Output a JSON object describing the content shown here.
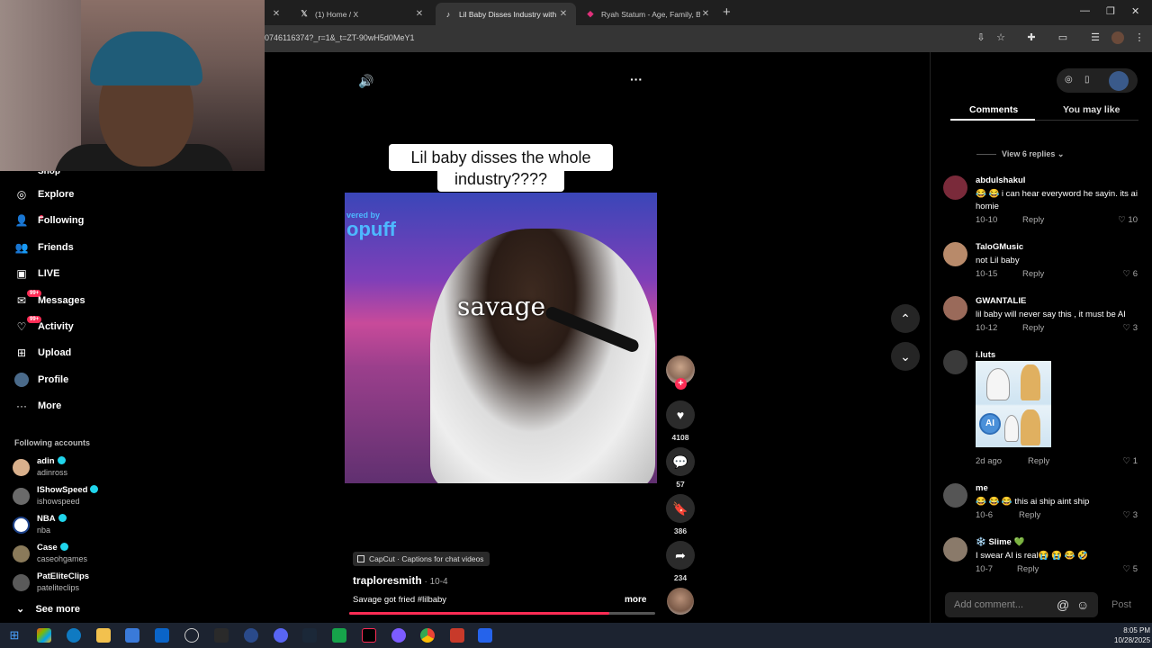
{
  "browser": {
    "tabs": [
      {
        "label": "(1) Home / X",
        "icon": "x-logo-icon"
      },
      {
        "label": "Lil Baby Disses Industry with Sa",
        "icon": "tiktok-logo-icon"
      },
      {
        "label": "Ryah Statum - Age, Family, Bio",
        "icon": "site-icon"
      }
    ],
    "url": "0746116374?_r=1&_t=ZT-90wH5d0MeY1"
  },
  "sidebar": {
    "partial_item": "Shop",
    "items": [
      {
        "label": "Explore",
        "icon": "compass-icon"
      },
      {
        "label": "Following",
        "icon": "following-icon"
      },
      {
        "label": "Friends",
        "icon": "friends-icon"
      },
      {
        "label": "LIVE",
        "icon": "live-icon"
      },
      {
        "label": "Messages",
        "icon": "messages-icon",
        "badge": "99+"
      },
      {
        "label": "Activity",
        "icon": "activity-icon",
        "badge": "99+"
      },
      {
        "label": "Upload",
        "icon": "upload-icon"
      },
      {
        "label": "Profile",
        "icon": "profile-icon"
      },
      {
        "label": "More",
        "icon": "more-dots-icon"
      }
    ],
    "following_title": "Following accounts",
    "following": [
      {
        "name": "adin",
        "user": "adinross",
        "verified": true,
        "color": "#d9b08c"
      },
      {
        "name": "IShowSpeed",
        "user": "ishowspeed",
        "verified": true,
        "color": "#6a6a6a"
      },
      {
        "name": "NBA",
        "user": "nba",
        "verified": true,
        "color": "#1d428a"
      },
      {
        "name": "Case",
        "user": "caseohgames",
        "verified": true,
        "color": "#8a7a5a"
      },
      {
        "name": "PatEliteClips",
        "user": "pateliteclips",
        "verified": false,
        "color": "#5a5a5a"
      }
    ],
    "see_more": "See more"
  },
  "video": {
    "caption_line1": "Lil baby disses the whole",
    "caption_line2": "industry????",
    "watermark_small": "vered by",
    "watermark_big": "opuff",
    "overlay_text": "savage",
    "capcut_label": "CapCut · Captions for chat videos",
    "author": "traploresmith",
    "date": "10-4",
    "description": "Savage got fried #lilbaby",
    "more_label": "more",
    "progress": 0.85
  },
  "actions": {
    "likes": "4108",
    "comments": "57",
    "saves": "386",
    "shares": "234"
  },
  "panel": {
    "tab_comments": "Comments",
    "tab_you_may_like": "You may like",
    "view_replies": "View 6 replies",
    "comments": [
      {
        "user": "abdulshakul",
        "text": "😂 😂 i can hear everyword he sayin. its ai homie",
        "date": "10-10",
        "likes": "10",
        "color": "#7a2a3a"
      },
      {
        "user": "TaloGMusic",
        "text": "not Lil baby",
        "date": "10-15",
        "likes": "6",
        "color": "#b88a6a"
      },
      {
        "user": "GWANTALIE",
        "text": "lil baby will never say this , it must be AI",
        "date": "10-12",
        "likes": "3",
        "color": "#9a6a5a"
      },
      {
        "user": "i.luts",
        "text": "",
        "date": "2d ago",
        "likes": "1",
        "color": "#3a3a3a",
        "gif_badge": "AI"
      },
      {
        "user": "me",
        "text": "😂 😂 😂 this ai ship aint ship",
        "date": "10-6",
        "likes": "3",
        "color": "#555555"
      },
      {
        "user": "❄️ Slime 💚",
        "text": "I swear AI is real😭 😭 😂 🤣",
        "date": "10-7",
        "likes": "5",
        "color": "#8a7a6a"
      }
    ],
    "reply_label": "Reply",
    "add_comment_placeholder": "Add comment...",
    "post_label": "Post"
  },
  "taskbar": {
    "time": "8:05 PM",
    "date": "10/28/2025"
  },
  "colors": {
    "accent": "#fe2c55",
    "verified": "#20d5ec"
  }
}
